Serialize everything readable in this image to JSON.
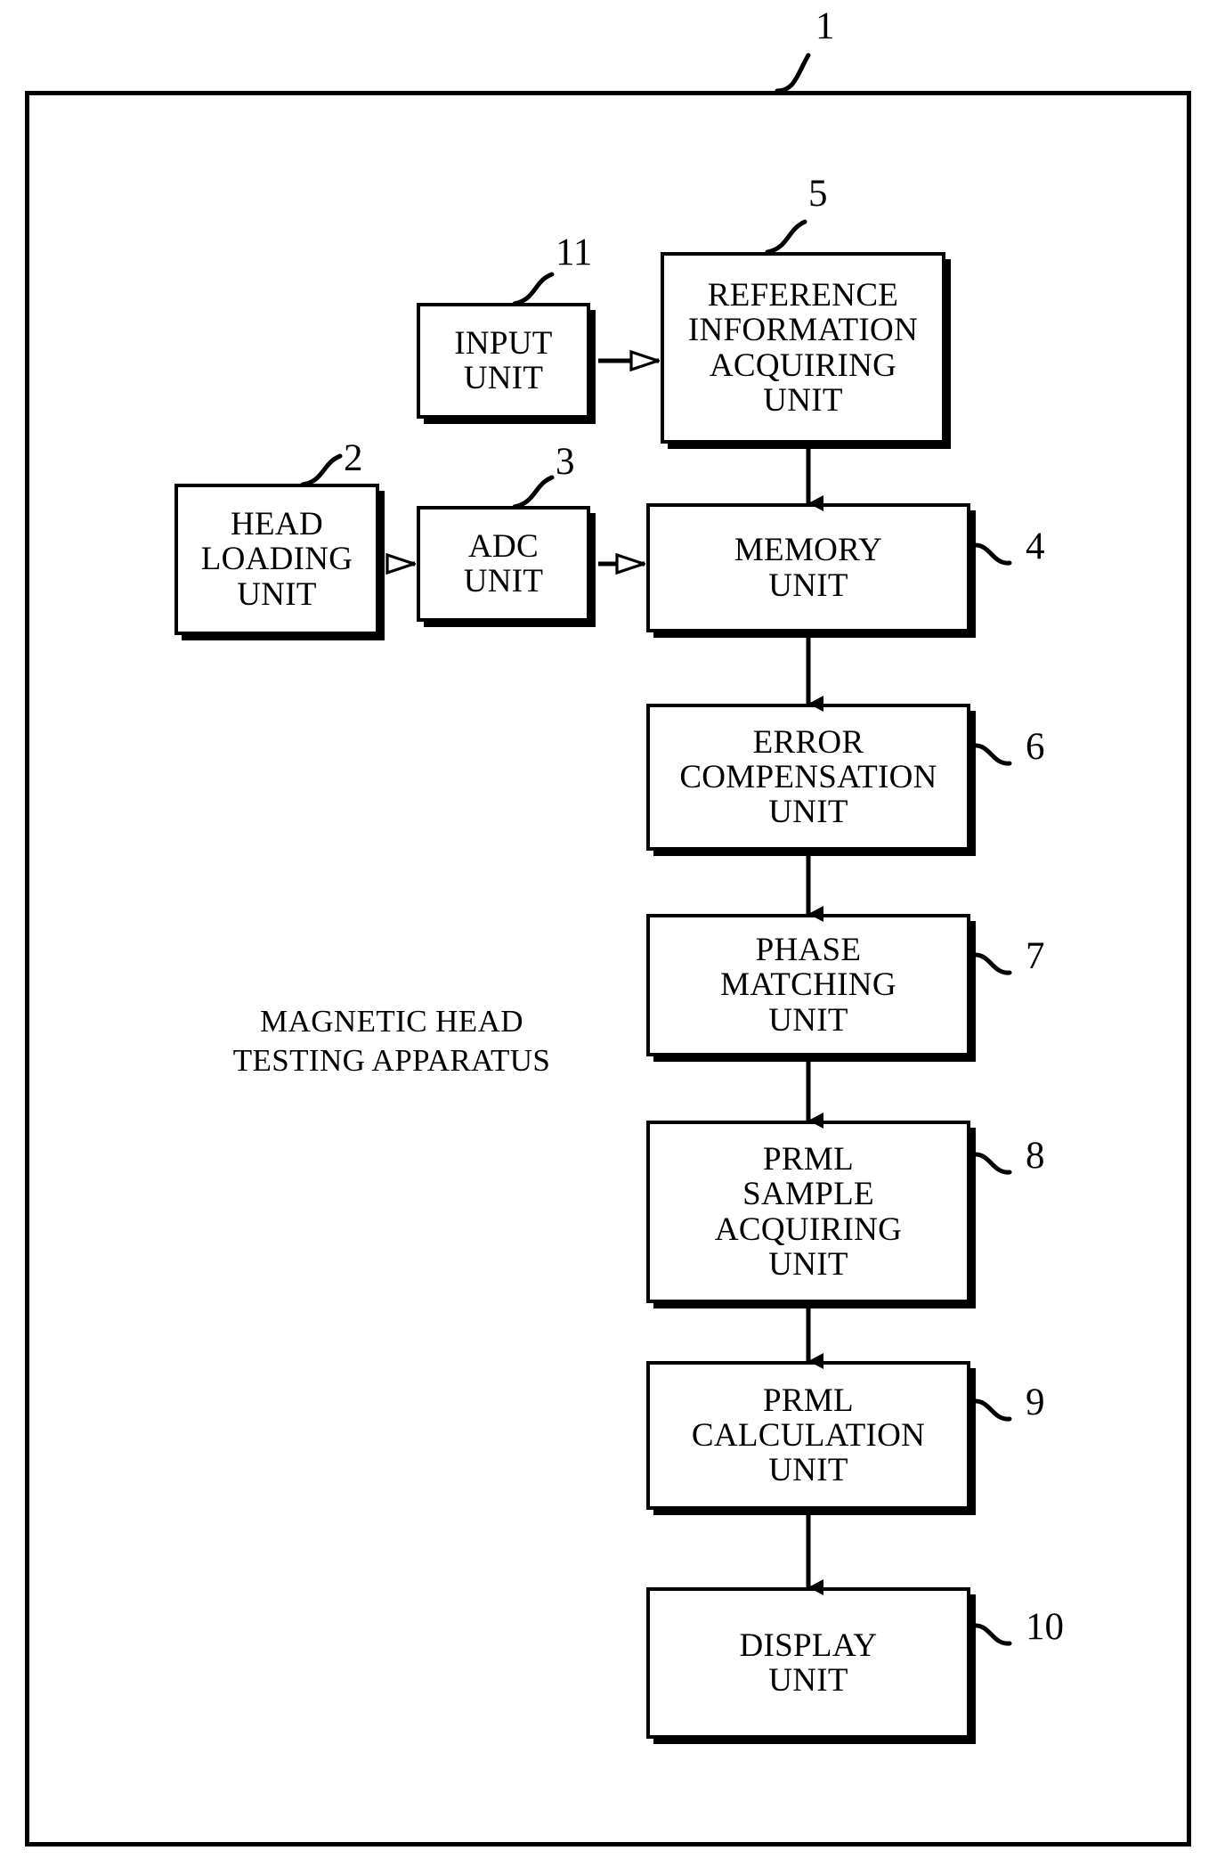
{
  "figure": {
    "type": "patent-block-diagram",
    "apparatus_caption": "MAGNETIC HEAD\nTESTING APPARATUS",
    "outer_ref": "1"
  },
  "blocks": [
    {
      "id": "input-unit",
      "label": "INPUT\nUNIT",
      "ref": "11",
      "ref_side": "top",
      "font_size": 37
    },
    {
      "id": "reference-info",
      "label": "REFERENCE\nINFORMATION\nACQUIRING\nUNIT",
      "ref": "5",
      "ref_side": "top",
      "font_size": 37
    },
    {
      "id": "head-loading-unit",
      "label": "HEAD\nLOADING\nUNIT",
      "ref": "2",
      "ref_side": "top",
      "font_size": 37
    },
    {
      "id": "adc-unit",
      "label": "ADC\nUNIT",
      "ref": "3",
      "ref_side": "top",
      "font_size": 37
    },
    {
      "id": "memory-unit",
      "label": "MEMORY\nUNIT",
      "ref": "4",
      "ref_side": "right",
      "font_size": 37
    },
    {
      "id": "error-compensation",
      "label": "ERROR\nCOMPENSATION\nUNIT",
      "ref": "6",
      "ref_side": "right",
      "font_size": 37
    },
    {
      "id": "phase-matching",
      "label": "PHASE\nMATCHING\nUNIT",
      "ref": "7",
      "ref_side": "right",
      "font_size": 37
    },
    {
      "id": "prml-sample",
      "label": "PRML\nSAMPLE\nACQUIRING\nUNIT",
      "ref": "8",
      "ref_side": "right",
      "font_size": 37
    },
    {
      "id": "prml-calculation",
      "label": "PRML\nCALCULATION\nUNIT",
      "ref": "9",
      "ref_side": "right",
      "font_size": 37
    },
    {
      "id": "display-unit",
      "label": "DISPLAY\nUNIT",
      "ref": "10",
      "ref_side": "right",
      "font_size": 37
    }
  ],
  "connections": [
    {
      "from": "input-unit",
      "to": "reference-info",
      "style": "hollow",
      "orientation": "horizontal"
    },
    {
      "from": "head-loading-unit",
      "to": "adc-unit",
      "style": "hollow",
      "orientation": "horizontal"
    },
    {
      "from": "adc-unit",
      "to": "memory-unit",
      "style": "hollow",
      "orientation": "horizontal"
    },
    {
      "from": "reference-info",
      "to": "memory-unit",
      "style": "solid",
      "orientation": "vertical"
    },
    {
      "from": "memory-unit",
      "to": "error-compensation",
      "style": "solid",
      "orientation": "vertical"
    },
    {
      "from": "error-compensation",
      "to": "phase-matching",
      "style": "solid",
      "orientation": "vertical"
    },
    {
      "from": "phase-matching",
      "to": "prml-sample",
      "style": "solid",
      "orientation": "vertical"
    },
    {
      "from": "prml-sample",
      "to": "prml-calculation",
      "style": "solid",
      "orientation": "vertical"
    },
    {
      "from": "prml-calculation",
      "to": "display-unit",
      "style": "solid",
      "orientation": "vertical"
    }
  ],
  "colors": {
    "ink": "#000000",
    "paper": "#ffffff"
  }
}
